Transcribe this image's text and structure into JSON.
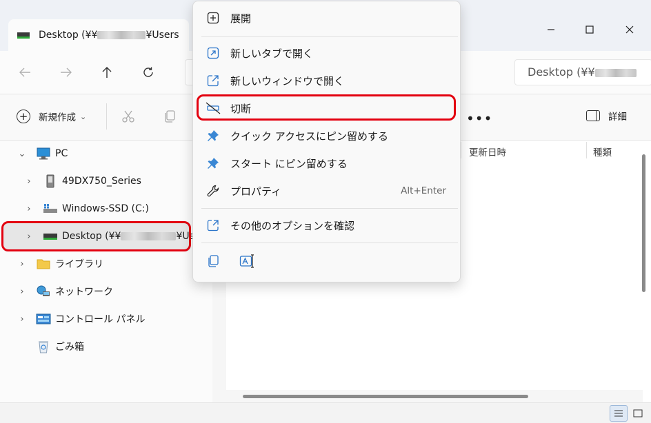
{
  "window": {
    "tab_title_prefix": "Desktop (¥¥",
    "tab_title_suffix": "¥Users"
  },
  "address": {
    "search_prefix": "Desktop (¥¥"
  },
  "toolbar": {
    "new_label": "新規作成",
    "new_dropdown": "⌄",
    "more_label": "•••",
    "details_label": "詳細"
  },
  "columns": {
    "modified": "更新日時",
    "type": "種類"
  },
  "sidebar": {
    "items": [
      {
        "label": "PC",
        "chevron": "⌄",
        "icon": "monitor-icon"
      },
      {
        "label": "49DX750_Series",
        "chevron": "›",
        "icon": "device-icon"
      },
      {
        "label": "Windows-SSD (C:)",
        "chevron": "›",
        "icon": "drive-icon"
      },
      {
        "label_prefix": "Desktop (¥¥",
        "label_suffix": "¥Use",
        "chevron": "›",
        "icon": "network-drive-icon"
      },
      {
        "label": "ライブラリ",
        "chevron": "›",
        "icon": "folder-icon"
      },
      {
        "label": "ネットワーク",
        "chevron": "›",
        "icon": "network-icon"
      },
      {
        "label": "コントロール パネル",
        "chevron": "›",
        "icon": "control-panel-icon"
      },
      {
        "label": "ごみ箱",
        "icon": "recycle-bin-icon"
      }
    ]
  },
  "context_menu": {
    "items": [
      {
        "label": "展開",
        "icon": "expand-icon"
      },
      {
        "label": "新しいタブで開く",
        "icon": "open-tab-icon"
      },
      {
        "label": "新しいウィンドウで開く",
        "icon": "open-window-icon"
      },
      {
        "label": "切断",
        "icon": "disconnect-icon"
      },
      {
        "label": "クイック アクセスにピン留めする",
        "icon": "pin-icon"
      },
      {
        "label": "スタート にピン留めする",
        "icon": "pin-start-icon"
      },
      {
        "label": "プロパティ",
        "icon": "wrench-icon",
        "shortcut": "Alt+Enter"
      },
      {
        "label": "その他のオプションを確認",
        "icon": "more-options-icon"
      }
    ],
    "bottom_icons": [
      "copy-icon",
      "rename-icon"
    ]
  },
  "colors": {
    "highlight": "#e3000f",
    "accent": "#2a74c9"
  }
}
